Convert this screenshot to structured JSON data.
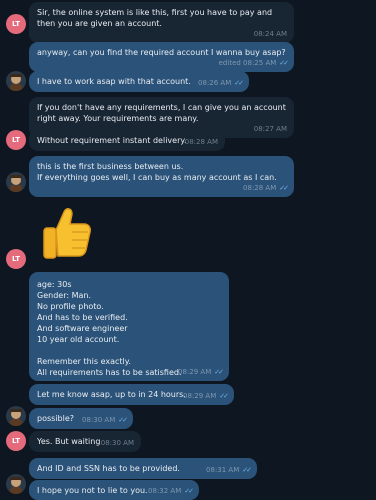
{
  "contact": {
    "initials": "LT"
  },
  "messages": [
    {
      "text": "Sir, the online system is like this, first you have to pay and then you are given an account.",
      "time": "08:24 AM"
    },
    {
      "text": "anyway, can you find the required account I wanna buy asap?",
      "time": "edited 08:25 AM"
    },
    {
      "text": "I have to work asap with that account.",
      "time": "08:26 AM"
    },
    {
      "text": "If you don't have any requirements, I can give you an account right away. Your requirements are many.",
      "time": "08:27 AM"
    },
    {
      "text": "Without requirement instant delivery.",
      "time": "08:28 AM"
    },
    {
      "text": "this is the first business between us.\nIf everything goes well, I can buy as many account as I can.",
      "time": "08:28 AM"
    },
    {
      "text": "age: 30s\nGender: Man.\nNo profile photo.\nAnd has to be verified.\nAnd software engineer\n10 year old account.\n\nRemember this exactly.\nAll requirements has to be satisfied.",
      "time": "08:29 AM"
    },
    {
      "text": "Let me know asap, up to in 24 hours.",
      "time": "08:29 AM"
    },
    {
      "text": "possible?",
      "time": "08:30 AM"
    },
    {
      "text": "Yes. But waiting",
      "time": "08:30 AM"
    },
    {
      "text": "And ID and SSN has to be provided.",
      "time": "08:31 AM"
    },
    {
      "text": "I hope you not to lie to you.",
      "time": "08:32 AM"
    }
  ],
  "sticker": {
    "icon": "thumbs-up-icon"
  },
  "colors": {
    "incoming": "#182533",
    "outgoing": "#2b5278",
    "background": "#0e1621",
    "avatar": "#e46a7c",
    "ticks": "#6fb4ea"
  }
}
